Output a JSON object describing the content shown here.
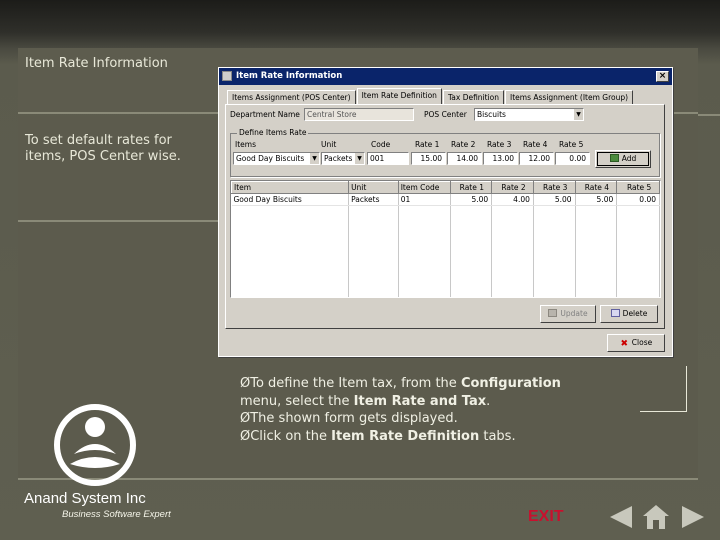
{
  "slide": {
    "title": "Item Rate Information",
    "description": "To set default rates for items, POS Center wise.",
    "bullets": [
      {
        "parts": [
          {
            "t": "ØTo define the Item tax, from the ",
            "b": false
          },
          {
            "t": "Configuration",
            "b": true
          }
        ]
      },
      {
        "parts": [
          {
            "t": "menu, select the ",
            "b": false
          },
          {
            "t": "Item Rate and Tax",
            "b": true
          },
          {
            "t": ".",
            "b": false
          }
        ]
      },
      {
        "parts": [
          {
            "t": "ØThe shown form gets displayed.",
            "b": false
          }
        ]
      },
      {
        "parts": [
          {
            "t": "ØClick on the ",
            "b": false
          },
          {
            "t": "Item Rate Definition",
            "b": true
          },
          {
            "t": " tabs.",
            "b": false
          }
        ]
      }
    ],
    "brand": "Anand System Inc",
    "tagline": "Business Software Expert",
    "exit_label": "EXIT",
    "colors": {
      "background": "#5c5b4d",
      "exit": "#c8102e",
      "nav": "#c8c8bc"
    }
  },
  "dialog": {
    "title": "Item Rate Information",
    "close_glyph": "×",
    "tabs": [
      "Items Assignment (POS Center)",
      "Item Rate Definition",
      "Tax Definition",
      "Items Assignment (Item Group)"
    ],
    "active_tab": 1,
    "department_label": "Department Name",
    "department_value": "Central Store",
    "pos_center_label": "POS Center",
    "pos_center_value": "Biscuits",
    "group_title": "Define Items Rate",
    "entry_labels": {
      "items": "Items",
      "unit": "Unit",
      "code": "Code",
      "rate1": "Rate 1",
      "rate2": "Rate 2",
      "rate3": "Rate 3",
      "rate4": "Rate 4",
      "rate5": "Rate 5"
    },
    "entry_values": {
      "items": "Good Day Biscuits",
      "unit": "Packets",
      "code": "001",
      "rate1": "15.00",
      "rate2": "14.00",
      "rate3": "13.00",
      "rate4": "12.00",
      "rate5": "0.00"
    },
    "add_label": "Add",
    "grid": {
      "columns": [
        "Item",
        "Unit",
        "Item Code",
        "Rate 1",
        "Rate 2",
        "Rate 3",
        "Rate 4",
        "Rate 5"
      ],
      "rows": [
        [
          "Good Day Biscuits",
          "Packets",
          "01",
          "5.00",
          "4.00",
          "5.00",
          "5.00",
          "0.00"
        ]
      ]
    },
    "update_label": "Update",
    "delete_label": "Delete",
    "close_label": "Close"
  }
}
